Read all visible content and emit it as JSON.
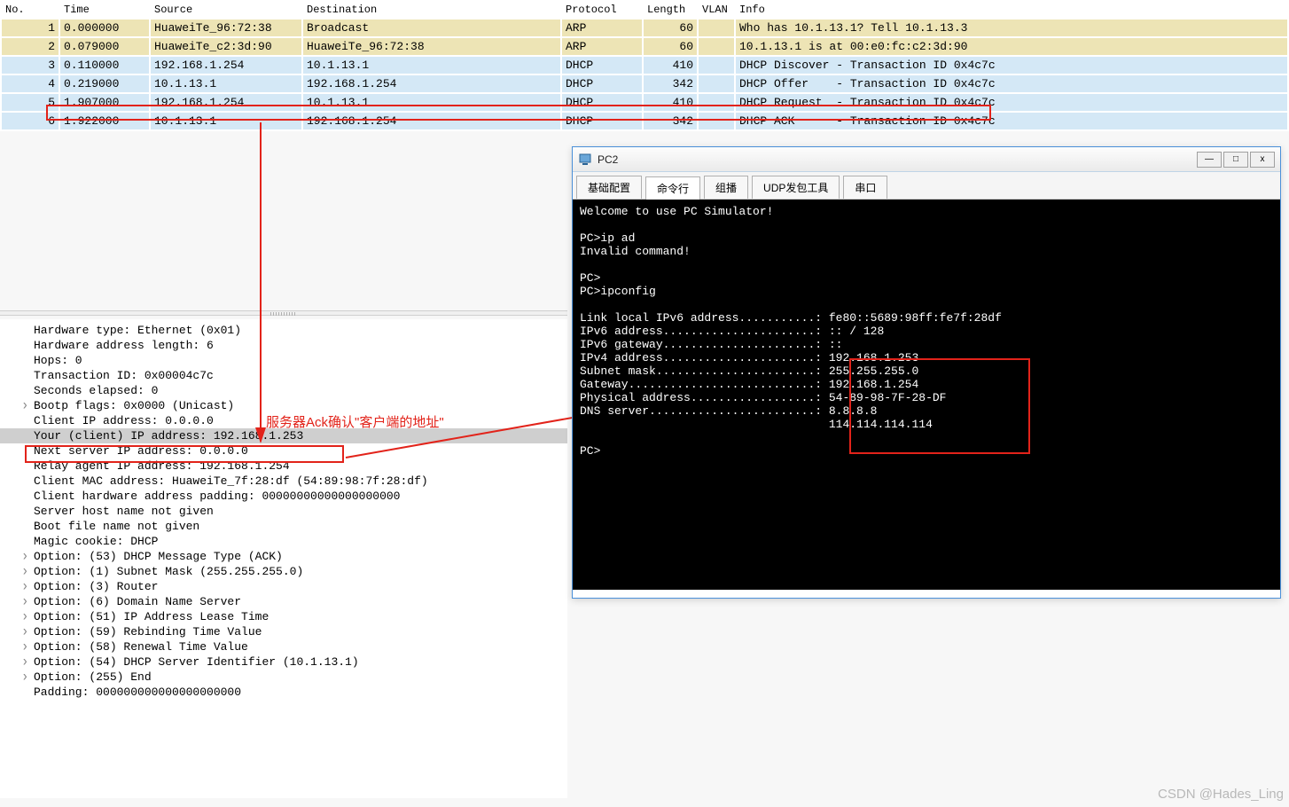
{
  "packet_table": {
    "columns": [
      "No.",
      "Time",
      "Source",
      "Destination",
      "Protocol",
      "Length",
      "VLAN",
      "Info"
    ],
    "rows": [
      {
        "no": "1",
        "time": "0.000000",
        "src": "HuaweiTe_96:72:38",
        "dst": "Broadcast",
        "proto": "ARP",
        "len": "60",
        "vlan": "",
        "info": "Who has 10.1.13.1? Tell 10.1.13.3",
        "cls": "row-alt"
      },
      {
        "no": "2",
        "time": "0.079000",
        "src": "HuaweiTe_c2:3d:90",
        "dst": "HuaweiTe_96:72:38",
        "proto": "ARP",
        "len": "60",
        "vlan": "",
        "info": "10.1.13.1 is at 00:e0:fc:c2:3d:90",
        "cls": "row-alt"
      },
      {
        "no": "3",
        "time": "0.110000",
        "src": "192.168.1.254",
        "dst": "10.1.13.1",
        "proto": "DHCP",
        "len": "410",
        "vlan": "",
        "info": "DHCP Discover - Transaction ID 0x4c7c",
        "cls": "row-dhcp"
      },
      {
        "no": "4",
        "time": "0.219000",
        "src": "10.1.13.1",
        "dst": "192.168.1.254",
        "proto": "DHCP",
        "len": "342",
        "vlan": "",
        "info": "DHCP Offer    - Transaction ID 0x4c7c",
        "cls": "row-dhcp"
      },
      {
        "no": "5",
        "time": "1.907000",
        "src": "192.168.1.254",
        "dst": "10.1.13.1",
        "proto": "DHCP",
        "len": "410",
        "vlan": "",
        "info": "DHCP Request  - Transaction ID 0x4c7c",
        "cls": "row-dhcp"
      },
      {
        "no": "6",
        "time": "1.922000",
        "src": "10.1.13.1",
        "dst": "192.168.1.254",
        "proto": "DHCP",
        "len": "342",
        "vlan": "",
        "info": "DHCP ACK      - Transaction ID 0x4c7c",
        "cls": "row-dhcp"
      }
    ]
  },
  "detail": {
    "lines": [
      {
        "text": "Hardware type: Ethernet (0x01)",
        "expand": false
      },
      {
        "text": "Hardware address length: 6",
        "expand": false
      },
      {
        "text": "Hops: 0",
        "expand": false
      },
      {
        "text": "Transaction ID: 0x00004c7c",
        "expand": false
      },
      {
        "text": "Seconds elapsed: 0",
        "expand": false
      },
      {
        "text": "Bootp flags: 0x0000 (Unicast)",
        "expand": true
      },
      {
        "text": "Client IP address: 0.0.0.0",
        "expand": false
      },
      {
        "text": "Your (client) IP address: 192.168.1.253",
        "expand": false,
        "selected": true
      },
      {
        "text": "Next server IP address: 0.0.0.0",
        "expand": false
      },
      {
        "text": "Relay agent IP address: 192.168.1.254",
        "expand": false
      },
      {
        "text": "Client MAC address: HuaweiTe_7f:28:df (54:89:98:7f:28:df)",
        "expand": false
      },
      {
        "text": "Client hardware address padding: 00000000000000000000",
        "expand": false
      },
      {
        "text": "Server host name not given",
        "expand": false
      },
      {
        "text": "Boot file name not given",
        "expand": false
      },
      {
        "text": "Magic cookie: DHCP",
        "expand": false
      },
      {
        "text": "Option: (53) DHCP Message Type (ACK)",
        "expand": true
      },
      {
        "text": "Option: (1) Subnet Mask (255.255.255.0)",
        "expand": true
      },
      {
        "text": "Option: (3) Router",
        "expand": true
      },
      {
        "text": "Option: (6) Domain Name Server",
        "expand": true
      },
      {
        "text": "Option: (51) IP Address Lease Time",
        "expand": true
      },
      {
        "text": "Option: (59) Rebinding Time Value",
        "expand": true
      },
      {
        "text": "Option: (58) Renewal Time Value",
        "expand": true
      },
      {
        "text": "Option: (54) DHCP Server Identifier (10.1.13.1)",
        "expand": true
      },
      {
        "text": "Option: (255) End",
        "expand": true
      },
      {
        "text": "Padding: 000000000000000000000",
        "expand": false
      }
    ]
  },
  "pc_window": {
    "title": "PC2",
    "tabs": [
      "基础配置",
      "命令行",
      "组播",
      "UDP发包工具",
      "串口"
    ],
    "active_tab": 1,
    "console": "Welcome to use PC Simulator!\n\nPC>ip ad\nInvalid command!\n\nPC>\nPC>ipconfig\n\nLink local IPv6 address...........: fe80::5689:98ff:fe7f:28df\nIPv6 address......................: :: / 128\nIPv6 gateway......................: ::\nIPv4 address......................: 192.168.1.253\nSubnet mask.......................: 255.255.255.0\nGateway...........................: 192.168.1.254\nPhysical address..................: 54-89-98-7F-28-DF\nDNS server........................: 8.8.8.8\n                                    114.114.114.114\n\nPC>"
  },
  "annotation": {
    "text": "服务器Ack确认\"客户端的地址\""
  },
  "watermark": "CSDN @Hades_Ling"
}
